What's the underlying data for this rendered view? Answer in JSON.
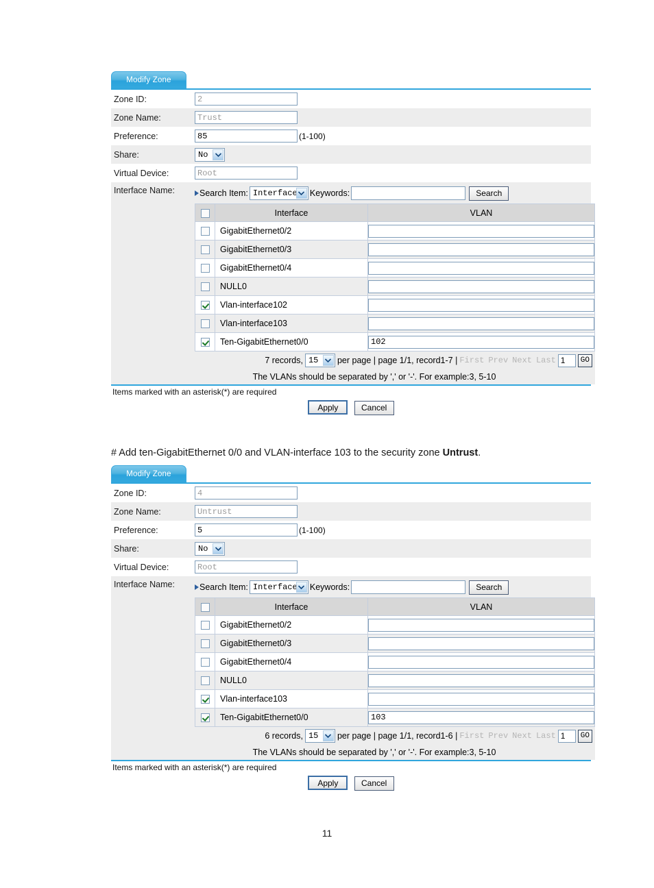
{
  "document": {
    "page_number": "11",
    "narrative": {
      "prefix": "# Add ten-GigabitEthernet 0/0 and VLAN-interface 103 to the security zone ",
      "bold": "Untrust",
      "suffix": "."
    }
  },
  "common": {
    "tab_label": "Modify Zone",
    "labels": {
      "zone_id": "Zone ID:",
      "zone_name": "Zone Name:",
      "preference": "Preference:",
      "share": "Share:",
      "virtual_device": "Virtual Device:",
      "interface_name": "Interface Name:"
    },
    "preference_hint": "(1-100)",
    "search": {
      "search_item_label": "Search Item:",
      "search_item_value": "Interface",
      "keywords_label": "Keywords:",
      "keywords_value": "",
      "keywords_placeholder": "",
      "search_button": "Search"
    },
    "table_headers": {
      "interface": "Interface",
      "vlan": "VLAN"
    },
    "pager": {
      "per_page_value": "15",
      "per_page_text": "per page | page 1/1, record ",
      "first": "First",
      "prev": "Prev",
      "next": "Next",
      "last": "Last",
      "page_input_value": "1",
      "go_label": "GO"
    },
    "vlan_help": "The VLANs should be separated by ',' or '-'. For example:3, 5-10",
    "required_note": "Items marked with an asterisk(*) are required",
    "buttons": {
      "apply": "Apply",
      "cancel": "Cancel"
    }
  },
  "form_trust": {
    "zone_id": "2",
    "zone_name": "Trust",
    "preference": "85",
    "share": "No",
    "virtual_device": "Root",
    "records_text": "7 records,",
    "record_range": "1-7 |",
    "rows": [
      {
        "checked": false,
        "interface": "GigabitEthernet0/2",
        "vlan": ""
      },
      {
        "checked": false,
        "interface": "GigabitEthernet0/3",
        "vlan": ""
      },
      {
        "checked": false,
        "interface": "GigabitEthernet0/4",
        "vlan": ""
      },
      {
        "checked": false,
        "interface": "NULL0",
        "vlan": ""
      },
      {
        "checked": true,
        "interface": "Vlan-interface102",
        "vlan": ""
      },
      {
        "checked": false,
        "interface": "Vlan-interface103",
        "vlan": ""
      },
      {
        "checked": true,
        "interface": "Ten-GigabitEthernet0/0",
        "vlan": "102"
      }
    ]
  },
  "form_untrust": {
    "zone_id": "4",
    "zone_name": "Untrust",
    "preference": "5",
    "share": "No",
    "virtual_device": "Root",
    "records_text": "6 records,",
    "record_range": "1-6 |",
    "rows": [
      {
        "checked": false,
        "interface": "GigabitEthernet0/2",
        "vlan": ""
      },
      {
        "checked": false,
        "interface": "GigabitEthernet0/3",
        "vlan": ""
      },
      {
        "checked": false,
        "interface": "GigabitEthernet0/4",
        "vlan": ""
      },
      {
        "checked": false,
        "interface": "NULL0",
        "vlan": ""
      },
      {
        "checked": true,
        "interface": "Vlan-interface103",
        "vlan": ""
      },
      {
        "checked": true,
        "interface": "Ten-GigabitEthernet0/0",
        "vlan": "103"
      }
    ]
  },
  "colors": {
    "tab_blue": "#30a6dd",
    "row_alt": "#ededed",
    "header_gray": "#d7d7d7",
    "check_green": "#1a7a28"
  }
}
